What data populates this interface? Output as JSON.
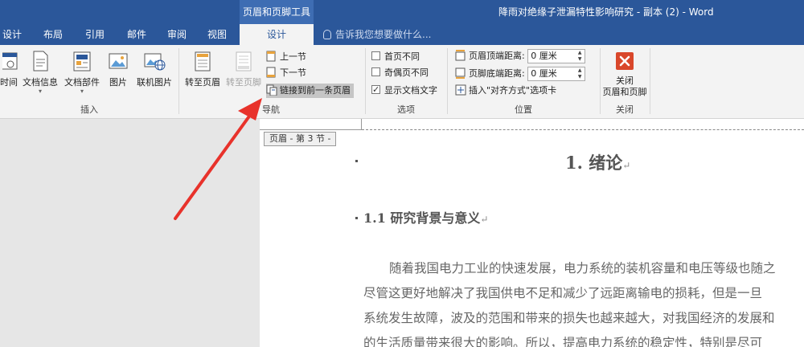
{
  "titlebar": {
    "context_header": "页眉和页脚工具",
    "document_title": "降雨对绝缘子泄漏特性影响研究 - 副本 (2) - Word"
  },
  "tabs": [
    {
      "label": "设计"
    },
    {
      "label": "布局"
    },
    {
      "label": "引用"
    },
    {
      "label": "邮件"
    },
    {
      "label": "审阅"
    },
    {
      "label": "视图"
    },
    {
      "label": "设计"
    }
  ],
  "tell_me": "告诉我您想要做什么...",
  "ribbon": {
    "insert_group": {
      "label": "插入",
      "buttons": [
        "时间",
        "文档信息",
        "文档部件",
        "图片",
        "联机图片"
      ]
    },
    "nav_group": {
      "label": "导航",
      "goto_header": "转至页眉",
      "goto_footer": "转至页脚",
      "prev_section": "上一节",
      "next_section": "下一节",
      "link_to_previous": "链接到前一条页眉"
    },
    "options_group": {
      "label": "选项",
      "different_first_page": "首页不同",
      "different_odd_even": "奇偶页不同",
      "show_document_text": "显示文档文字",
      "different_first_page_checked": false,
      "different_odd_even_checked": false,
      "show_document_text_checked": true
    },
    "position_group": {
      "label": "位置",
      "header_from_top_label": "页眉顶端距离:",
      "header_from_top_value": "0 厘米",
      "footer_from_bottom_label": "页脚底端距离:",
      "footer_from_bottom_value": "0 厘米",
      "insert_alignment_tab": "插入\"对齐方式\"选项卡"
    },
    "close_group": {
      "label": "关闭",
      "close_button": "关闭\n页眉和页脚",
      "close_line1": "关闭",
      "close_line2": "页眉和页脚"
    }
  },
  "document": {
    "header_tag": "页眉 - 第 3 节 -",
    "heading1": "1.  绪论",
    "heading2": "1.1 研究背景与意义",
    "paragraph_lines": [
      "随着我国电力工业的快速发展，电力系统的装机容量和电压等级也随之",
      "尽管这更好地解决了我国供电不足和减少了远距离输电的损耗，但是一旦",
      "系统发生故障，波及的范围和带来的损失也越来越大，对我国经济的发展和",
      "的生活质量带来很大的影响。所以，提高电力系统的稳定性，特别是尽可"
    ],
    "return_mark": "↵"
  },
  "colors": {
    "word_blue": "#2b579a",
    "arrow_red": "#e8322b"
  }
}
